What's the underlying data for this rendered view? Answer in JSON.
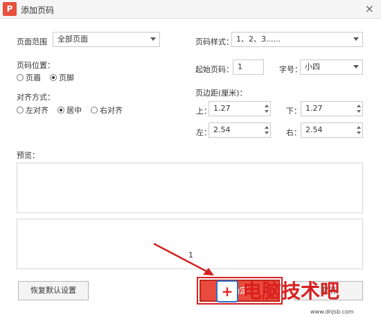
{
  "window": {
    "title": "添加页码",
    "app_icon": "wps-pdf-icon"
  },
  "page_range": {
    "label": "页面范围",
    "value": "全部页面"
  },
  "page_position": {
    "label": "页码位置：",
    "options": [
      "页眉",
      "页脚"
    ],
    "selected": "页脚"
  },
  "alignment": {
    "label": "对齐方式：",
    "options": [
      "左对齐",
      "居中",
      "右对齐"
    ],
    "selected": "居中"
  },
  "page_style": {
    "label": "页码样式：",
    "value": "1、2、3......"
  },
  "start_page": {
    "label": "起始页码：",
    "value": "1"
  },
  "font_size": {
    "label": "字号：",
    "value": "小四"
  },
  "margin": {
    "label": "页边距(厘米)：",
    "top_label": "上：",
    "top_value": "1.27",
    "bottom_label": "下：",
    "bottom_value": "1.27",
    "left_label": "左：",
    "left_value": "2.54",
    "right_label": "右：",
    "right_value": "2.54"
  },
  "preview": {
    "label": "预览：",
    "page_number": "1"
  },
  "buttons": {
    "restore_default": "恢复默认设置",
    "ok": "确定",
    "cancel": "取消"
  },
  "watermark": {
    "text": "电脑技术吧",
    "url": "www.dnjsb.com"
  },
  "colors": {
    "accent": "#e94b3c",
    "highlight": "#d42020",
    "titlebar": "#f5f5f5"
  }
}
